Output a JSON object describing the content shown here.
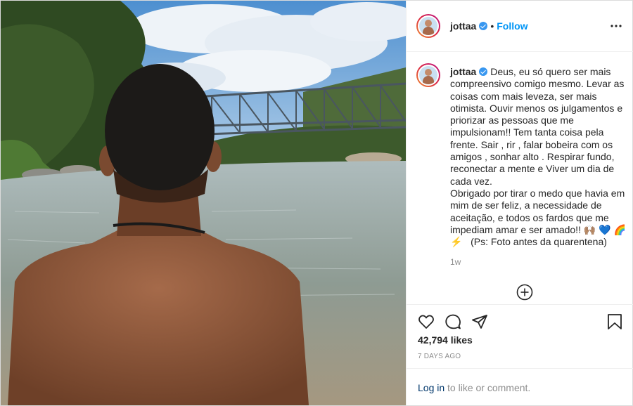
{
  "post": {
    "username": "jottaa",
    "follow_label": "Follow",
    "dot": "•",
    "caption": "Deus, eu só quero ser mais compreensivo comigo mesmo. Levar as coisas com mais leveza, ser mais otimista. Ouvir menos os julgamentos e priorizar as pessoas que me impulsionam!! Tem tanta coisa pela frente. Sair , rir , falar bobeira com os amigos , sonhar alto . Respirar fundo, reconectar a mente e Viver um dia de cada vez.\nObrigado por tirar o medo que havia em mim de ser feliz, a necessidade de aceitação, e todos os fardos que me impediam amar e ser amado!! 🙌🏽 💙 🌈 ⚡️   (Ps: Foto antes da quarentena)",
    "caption_age": "1w",
    "likes": "42,794 likes",
    "date": "7 DAYS AGO",
    "login_link": "Log in",
    "login_rest": " to like or comment."
  },
  "icons": {
    "more": "more-options-icon",
    "load_more": "plus-circle-icon",
    "like": "heart-icon",
    "comment": "comment-icon",
    "share": "paper-plane-icon",
    "save": "bookmark-icon",
    "verified": "verified-badge-icon"
  },
  "colors": {
    "link_blue": "#0095f6",
    "verified_blue": "#3897f0",
    "muted": "#8e8e8e",
    "text": "#262626"
  }
}
